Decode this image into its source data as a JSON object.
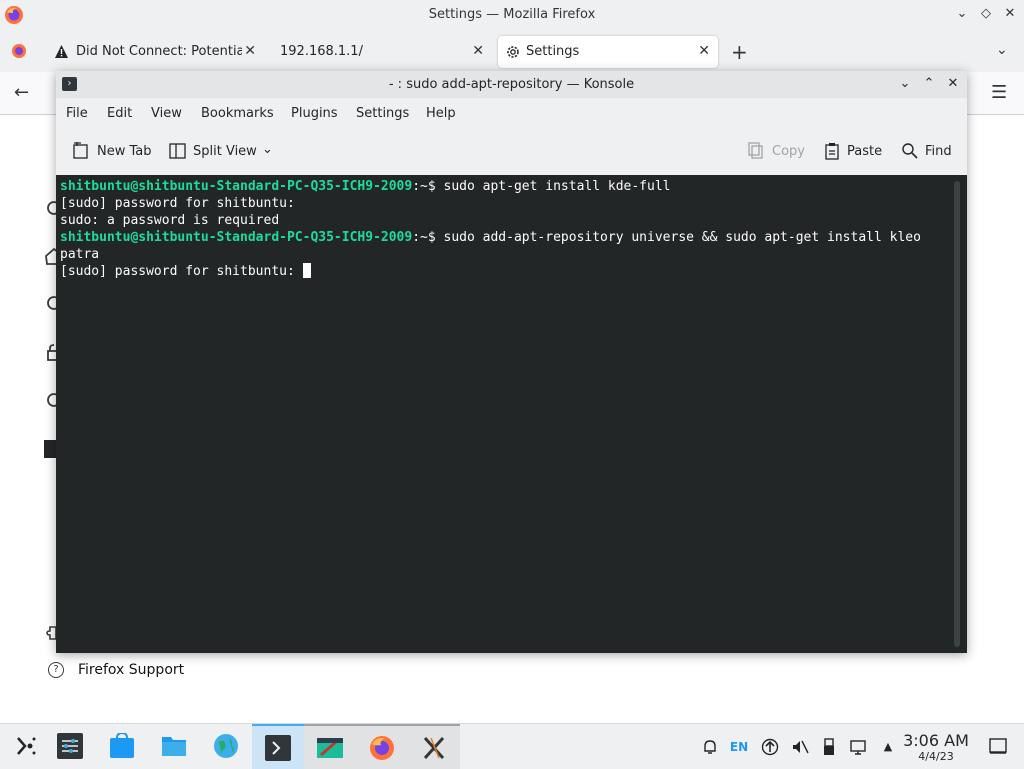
{
  "firefox": {
    "window_title": "Settings — Mozilla Firefox",
    "tabs": [
      {
        "label": "Did Not Connect: Potential",
        "icon": "warning-icon"
      },
      {
        "label": "192.168.1.1/",
        "icon": ""
      },
      {
        "label": "Settings",
        "icon": "gear-icon"
      }
    ],
    "new_tab_label": "+",
    "support_link": "Firefox Support"
  },
  "konsole": {
    "window_title": "- : sudo add-apt-repository — Konsole",
    "menu": [
      "File",
      "Edit",
      "View",
      "Bookmarks",
      "Plugins",
      "Settings",
      "Help"
    ],
    "toolbar": {
      "new_tab": "New Tab",
      "split_view": "Split View",
      "copy": "Copy",
      "paste": "Paste",
      "find": "Find"
    },
    "terminal": {
      "prompt": "shitbuntu@shitbuntu-Standard-PC-Q35-ICH9-2009",
      "path_suffix": ":~$ ",
      "cmd1": "sudo apt-get install kde-full",
      "out1": "[sudo] password for shitbuntu:",
      "out2": "sudo: a password is required",
      "cmd2": "sudo add-apt-repository universe && sudo apt-get install kleo",
      "cmd2_wrap": "patra",
      "out3": "[sudo] password for shitbuntu: "
    }
  },
  "taskbar": {
    "lang": "EN",
    "time": "3:06 AM",
    "date": "4/4/23",
    "colors": {
      "accent": "#3daee9",
      "prompt": "#1cdc9a",
      "terminal_bg": "#232627"
    }
  }
}
